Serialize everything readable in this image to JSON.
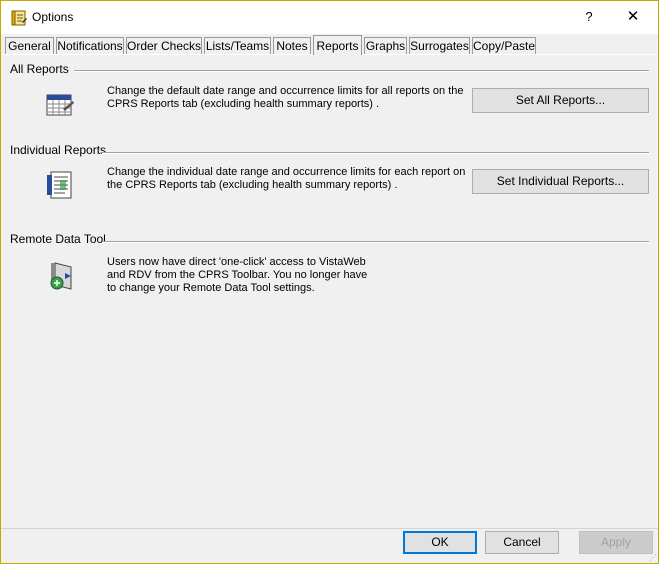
{
  "window": {
    "title": "Options",
    "help_glyph": "?",
    "close_glyph": "✕",
    "icon": "notepad-icon"
  },
  "tabs": [
    {
      "label": "General"
    },
    {
      "label": "Notifications"
    },
    {
      "label": "Order Checks"
    },
    {
      "label": "Lists/Teams"
    },
    {
      "label": "Notes"
    },
    {
      "label": "Reports",
      "active": true
    },
    {
      "label": "Graphs"
    },
    {
      "label": "Surrogates"
    },
    {
      "label": "Copy/Paste"
    }
  ],
  "sections": {
    "all_reports": {
      "title": "All Reports",
      "icon": "calendar-report-icon",
      "line1": "Change the default date range and occurrence limits for all reports on the",
      "line2": "CPRS Reports tab (excluding health summary reports) .",
      "button": "Set All Reports..."
    },
    "individual_reports": {
      "title": "Individual Reports",
      "icon": "report-document-icon",
      "line1": "Change the individual date range and occurrence limits for each report on",
      "line2": "the CPRS Reports tab (excluding health summary reports) .",
      "button": "Set Individual Reports..."
    },
    "remote_data_tool": {
      "title": "Remote Data Tool",
      "icon": "remote-data-icon",
      "line1": "Users now have direct 'one-click' access to VistaWeb",
      "line2": "and RDV from the CPRS Toolbar.  You no longer have",
      "line3": "to change your Remote Data Tool settings."
    }
  },
  "footer": {
    "ok": "OK",
    "cancel": "Cancel",
    "apply": "Apply"
  },
  "colors": {
    "accent": "#0078d7",
    "frame": "#c8a800"
  }
}
